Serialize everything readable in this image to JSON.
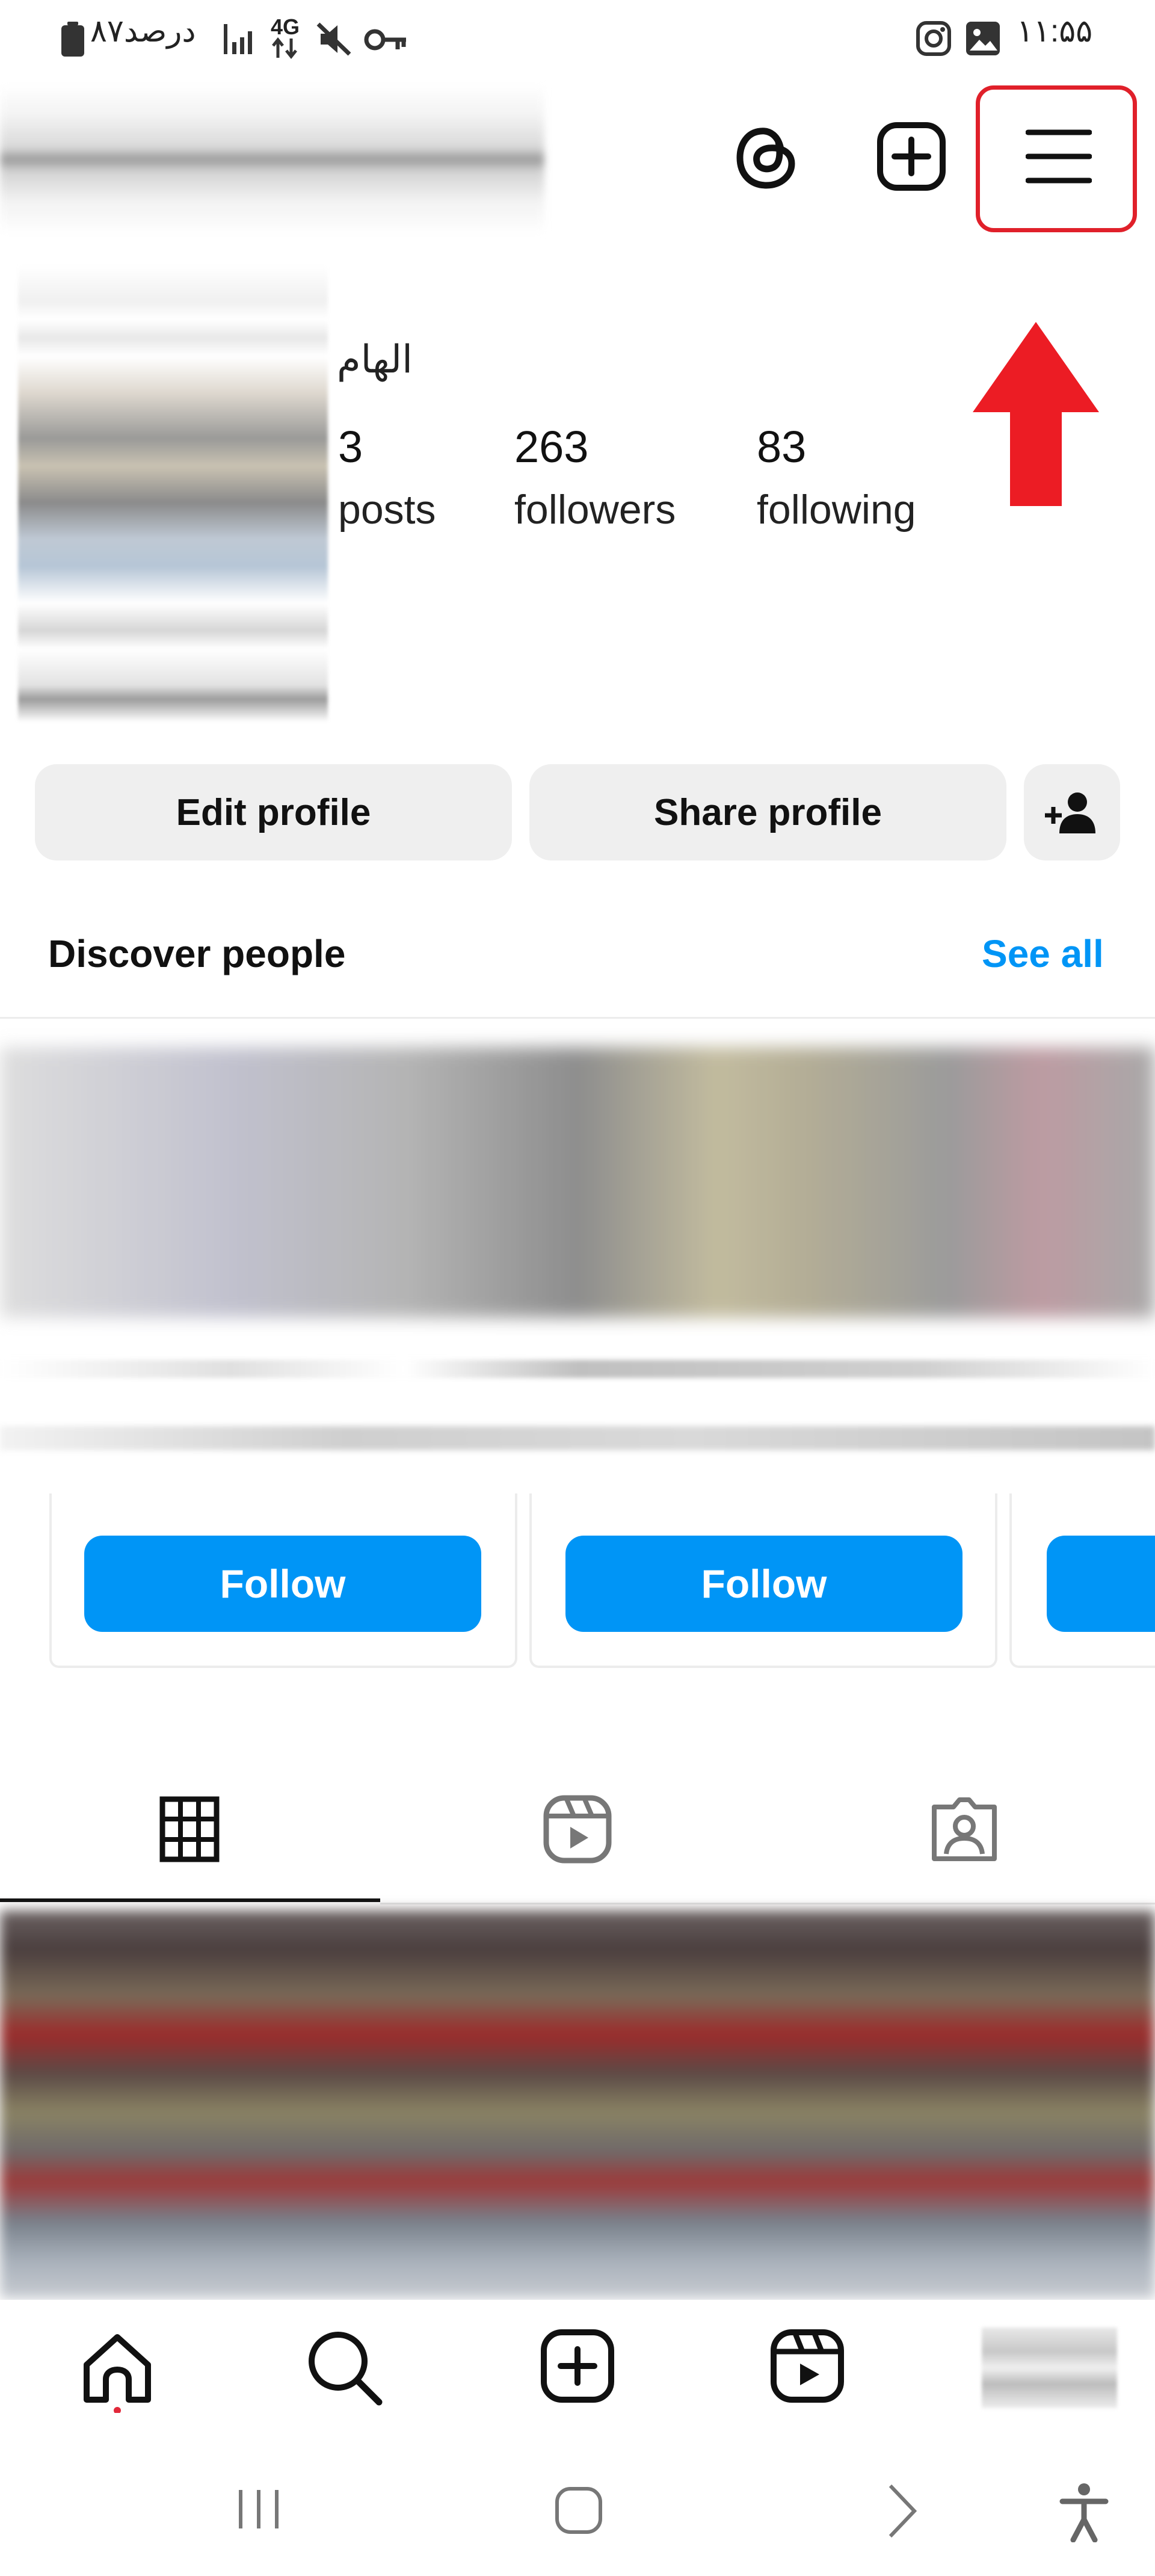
{
  "status_bar": {
    "left_text": "۸۷درصد",
    "network": "4G",
    "time": "۱۱:۵۵"
  },
  "profile": {
    "name": "الهام",
    "posts_count": "3",
    "posts_label": "posts",
    "followers_count": "263",
    "followers_label": "followers",
    "following_count": "83",
    "following_label": "following"
  },
  "actions": {
    "edit_profile": "Edit profile",
    "share_profile": "Share profile"
  },
  "discover": {
    "title": "Discover people",
    "see_all": "See all",
    "follow_1": "Follow",
    "follow_2": "Follow"
  },
  "colors": {
    "accent_blue": "#0095f6",
    "highlight_red": "#e0202a",
    "arrow_red": "#ec1c24"
  },
  "icons": {
    "header": [
      "threads-icon",
      "create-post-icon",
      "hamburger-menu-icon"
    ],
    "tabs": [
      "grid-icon",
      "reels-icon",
      "tagged-icon"
    ],
    "bottom_nav": [
      "home-icon",
      "search-icon",
      "create-icon",
      "reels-icon",
      "profile-avatar"
    ],
    "system_nav": [
      "recents-icon",
      "home-button-icon",
      "back-icon",
      "accessibility-icon"
    ]
  }
}
